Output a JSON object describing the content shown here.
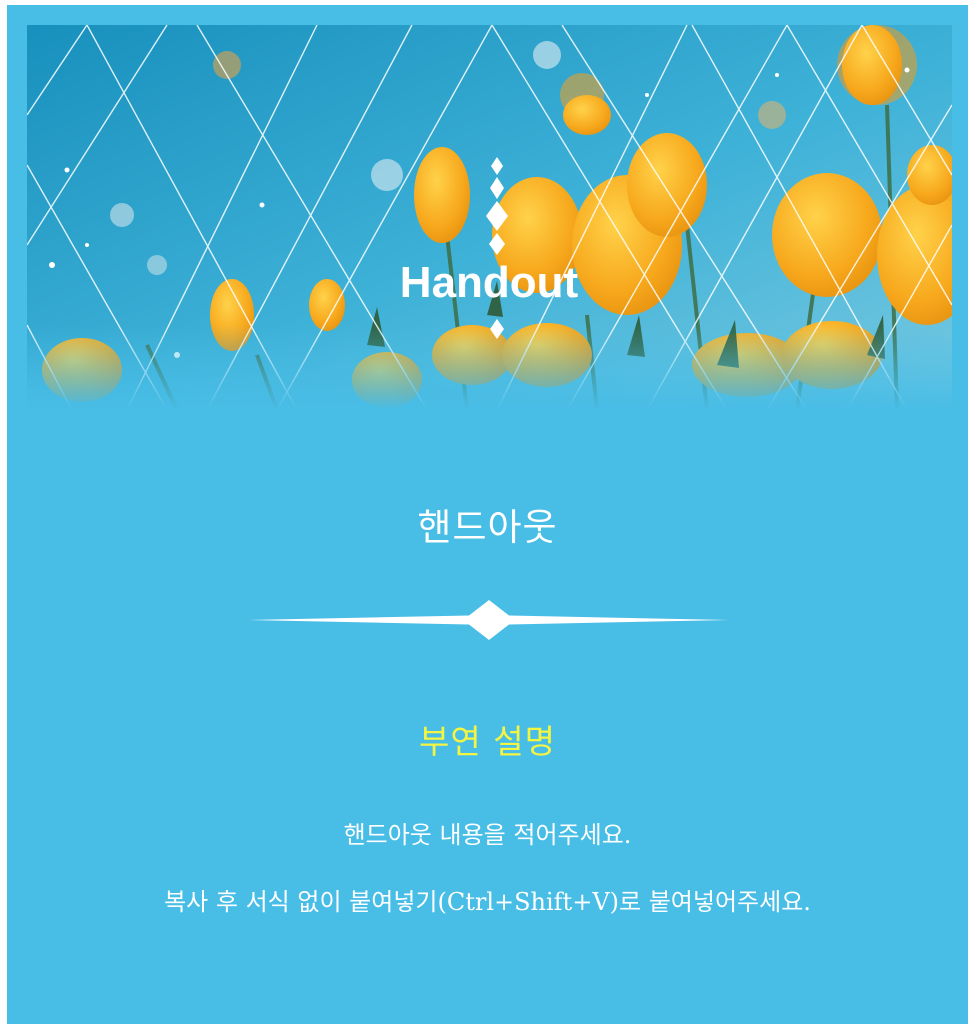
{
  "banner": {
    "logo_text": "Handout",
    "logo_icon": "diamond-chain-icon",
    "colors": {
      "sky": "#1f9fc7",
      "petal": "#f5a623",
      "stem": "#3e6b3f"
    }
  },
  "title": "핸드아웃",
  "subtitle": "부연 설명",
  "body": {
    "line1": "핸드아웃 내용을 적어주세요.",
    "line2": "복사 후 서식 없이 붙여넣기(Ctrl+Shift+V)로 붙여넣어주세요."
  },
  "colors": {
    "background": "#48bde6",
    "subtitle": "#f3f542",
    "text": "#ffffff"
  }
}
